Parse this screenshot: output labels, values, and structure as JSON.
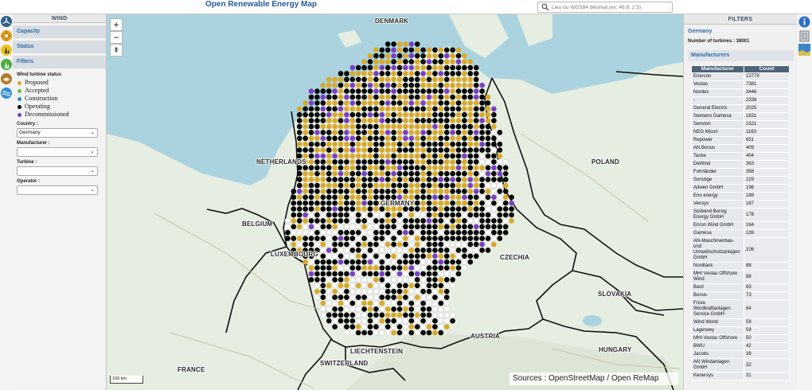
{
  "app": {
    "title": "Open Renewable Energy Map"
  },
  "search": {
    "placeholder": "Lieu ou WGS84 décimal (ex: 46.8, 2.5)"
  },
  "left_icons": [
    "wind-icon",
    "solar-icon",
    "geothermal-icon",
    "hydro-icon",
    "biomass-icon",
    "tidal-icon"
  ],
  "left_panel": {
    "title": "WIND",
    "capacity_label": "Capacity",
    "status_label": "Status",
    "filters_label": "Filters",
    "status_heading": "Wind turbine status",
    "legend": [
      {
        "label": "Proposed",
        "color": "#d9a92b"
      },
      {
        "label": "Accepted",
        "color": "#6cc04a"
      },
      {
        "label": "Construction",
        "color": "#2a8fd6"
      },
      {
        "label": "Operating",
        "color": "#000000"
      },
      {
        "label": "Decommissioned",
        "color": "#7a3fc4"
      }
    ],
    "country_label": "Country :",
    "country_value": "Germany",
    "manufacturer_label": "Manufacturer :",
    "manufacturer_value": "",
    "turbine_label": "Turbine :",
    "turbine_value": "",
    "operator_label": "Operator :",
    "operator_value": ""
  },
  "map": {
    "zoom_in": "+",
    "zoom_out": "−",
    "reset": "⇞",
    "scale": "100 km",
    "attribution": "Sources : OpenStreetMap / Open ReMap",
    "country_labels": [
      "DENMARK",
      "NETHERLANDS",
      "POLAND",
      "GERMANY",
      "BELGIUM",
      "LUXEMBOURG",
      "CZECHIA",
      "SLOVAKIA",
      "AUSTRIA",
      "LIECHTENSTEIN",
      "SWITZERLAND",
      "HUNGARY",
      "FRANCE"
    ]
  },
  "right_panel": {
    "title": "FILTERS",
    "country": "Germany",
    "turbine_count_label": "Number of turbines : 38001",
    "manufacturers_heading": "Manufacturers",
    "columns": [
      "Manufacturer",
      "Count"
    ],
    "rows": [
      [
        "Enercon",
        "13779"
      ],
      [
        "Vestas",
        "7381"
      ],
      [
        "Nordex",
        "3446"
      ],
      [
        "-",
        "2338"
      ],
      [
        "General Electric",
        "2025"
      ],
      [
        "Siemens Gamesa",
        "1831"
      ],
      [
        "Senvion",
        "1521"
      ],
      [
        "NEG Micon",
        "1163"
      ],
      [
        "Repower",
        "651"
      ],
      [
        "AN Bonus",
        "409"
      ],
      [
        "Tacke",
        "404"
      ],
      [
        "DeWind",
        "363"
      ],
      [
        "Fuhrländer",
        "358"
      ],
      [
        "Sonstige",
        "229"
      ],
      [
        "Adwen GmbH",
        "196"
      ],
      [
        "Eno energy",
        "188"
      ],
      [
        "Vensys",
        "187"
      ],
      [
        "Südwind Borsig Energy GmbH",
        "178"
      ],
      [
        "Enron Wind GmbH",
        "164"
      ],
      [
        "Gamesa",
        "139"
      ],
      [
        "AN-Maschinenbau- und Umweltschutzanlagen GmbH",
        "106"
      ],
      [
        "Nordtank",
        "88"
      ],
      [
        "MHI Vestas Offshore Wind",
        "88"
      ],
      [
        "Bard",
        "83"
      ],
      [
        "Bonus",
        "73"
      ],
      [
        "Frisia Windkraftanlagen Service GmbH",
        "64"
      ],
      [
        "Wind World",
        "59"
      ],
      [
        "Lagerwey",
        "59"
      ],
      [
        "MHI Vestas Offshore",
        "50"
      ],
      [
        "BWU",
        "42"
      ],
      [
        "Jacobs",
        "39"
      ],
      [
        "AN Windanlagen GmbH",
        "32"
      ],
      [
        "Kenersys",
        "31"
      ]
    ]
  },
  "right_icons": [
    "info-icon",
    "layers-icon",
    "map-thumbnail-icon"
  ]
}
